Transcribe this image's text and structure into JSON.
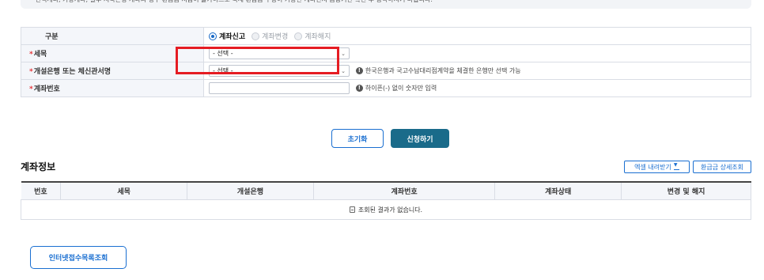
{
  "notice": {
    "text": "* 선택계좌, 가상계좌, 일부 저축은행 계좌의 경우 환급금 지급이 불가하므로 국세 환급금 수령이 가능한 계좌인지 금융기관 확인 후 등록하시기 바랍니다."
  },
  "form": {
    "category_label": "구분",
    "category_options": [
      {
        "label": "계좌신고",
        "selected": true
      },
      {
        "label": "계좌변경",
        "selected": false
      },
      {
        "label": "계좌해지",
        "selected": false
      }
    ],
    "tax_item_label": "세목",
    "tax_item_value": "- 선택 -",
    "bank_label": "개설은행 또는 체신관서명",
    "bank_value": "- 선택 -",
    "bank_hint": "한국은행과 국고수납대리점계약을 체결한 은행만 선택 가능",
    "account_label": "계좌번호",
    "account_value": "",
    "account_hint": "하이픈(-) 없이 숫자만 입력",
    "required_mark": "*"
  },
  "actions": {
    "reset": "초기화",
    "apply": "신청하기"
  },
  "account_info": {
    "title": "계좌정보",
    "excel_button": "엑셀 내려받기",
    "detail_button": "환급금 상세조회",
    "columns": [
      "번호",
      "세목",
      "개설은행",
      "계좌번호",
      "계좌상태",
      "변경 및 해지"
    ],
    "empty_message": "조회된 결과가 없습니다."
  },
  "bottom_button": "인터넷접수목록조회",
  "colors": {
    "accent": "#1a6fd1",
    "apply_bg": "#1a6b8a",
    "required": "#e6393c",
    "highlight": "#e51c23"
  }
}
